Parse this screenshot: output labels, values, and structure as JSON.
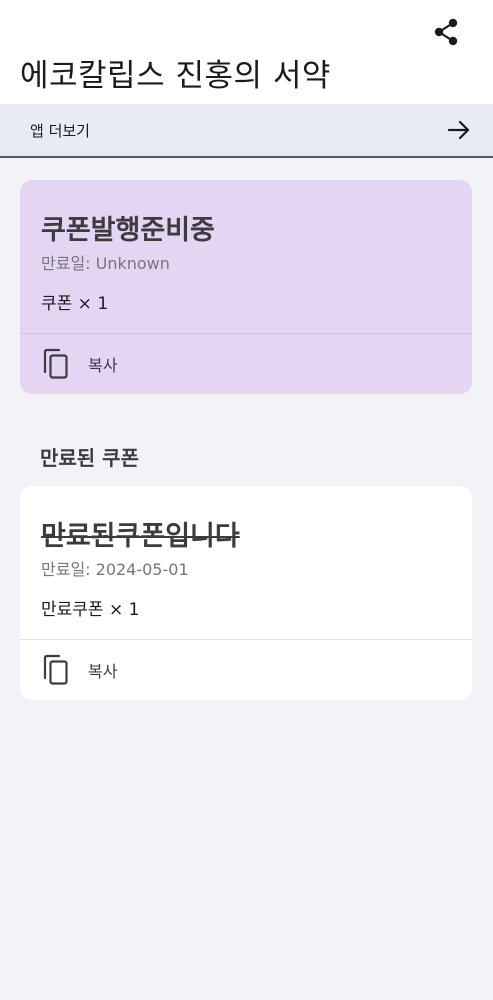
{
  "header": {
    "title": "에코칼립스 진홍의 서약",
    "share_icon": "share-icon"
  },
  "more_apps": {
    "label": "앱 더보기",
    "arrow_icon": "arrow-right-icon"
  },
  "active_coupon": {
    "name": "쿠폰발행준비중",
    "expiry": "만료일: Unknown",
    "quantity": "쿠폰 × 1",
    "copy_label": "복사"
  },
  "expired_section": {
    "title": "만료된 쿠폰"
  },
  "expired_coupon": {
    "name": "만료된쿠폰입니다",
    "expiry": "만료일: 2024-05-01",
    "quantity": "만료쿠폰 × 1",
    "copy_label": "복사"
  },
  "colors": {
    "background": "#f3f2f6",
    "active_card": "#e4d6f2",
    "more_bar": "#e8ebf6"
  }
}
